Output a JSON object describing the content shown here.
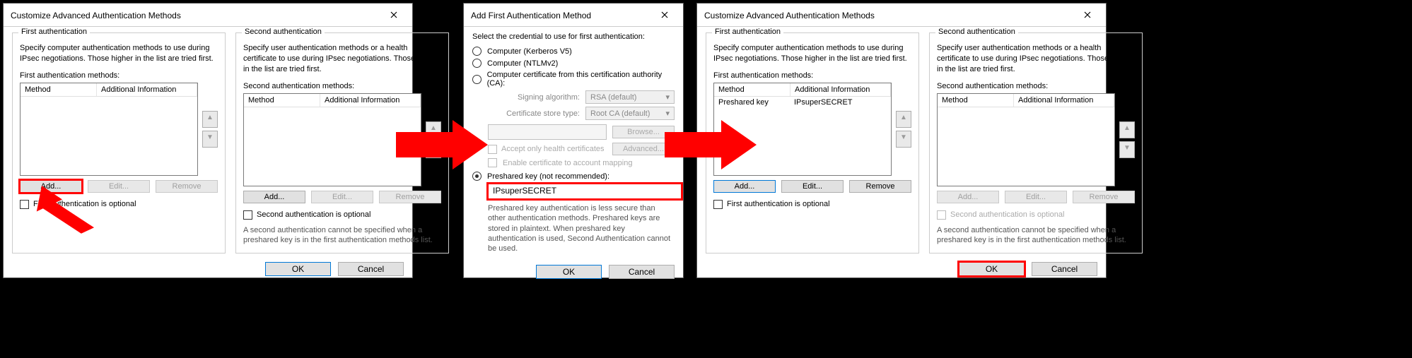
{
  "d1": {
    "title": "Customize Advanced Authentication Methods",
    "first": {
      "legend": "First authentication",
      "desc": "Specify computer authentication methods to use during IPsec negotiations.  Those higher in the list are tried first.",
      "list_label": "First authentication methods:",
      "col_method": "Method",
      "col_addl": "Additional Information",
      "add": "Add...",
      "edit": "Edit...",
      "remove": "Remove",
      "optional": "First authentication is optional"
    },
    "second": {
      "legend": "Second authentication",
      "desc": "Specify user authentication methods or a health certificate to use during IPsec negotiations.  Those higher in the list are tried first.",
      "list_label": "Second authentication methods:",
      "col_method": "Method",
      "col_addl": "Additional Information",
      "add": "Add...",
      "edit": "Edit...",
      "remove": "Remove",
      "optional": "Second authentication is optional",
      "note": "A second authentication cannot be specified when a preshared key is in the first authentication methods list."
    },
    "ok": "OK",
    "cancel": "Cancel"
  },
  "d2": {
    "title": "Add First Authentication Method",
    "intro": "Select the credential to use for first authentication:",
    "r1": "Computer (Kerberos V5)",
    "r2": "Computer (NTLMv2)",
    "r3": "Computer certificate from this certification authority (CA):",
    "signing_label": "Signing algorithm:",
    "signing_val": "RSA (default)",
    "store_label": "Certificate store type:",
    "store_val": "Root CA (default)",
    "browse": "Browse...",
    "advanced": "Advanced...",
    "chk_health": "Accept only health certificates",
    "chk_mapping": "Enable certificate to account mapping",
    "r4": "Preshared key (not recommended):",
    "psk_value": "IPsuperSECRET",
    "warn": "Preshared key authentication is less secure than other authentication methods. Preshared keys are stored in plaintext. When preshared key authentication is used, Second Authentication cannot be used.",
    "ok": "OK",
    "cancel": "Cancel"
  },
  "d3": {
    "title": "Customize Advanced Authentication Methods",
    "first": {
      "legend": "First authentication",
      "desc": "Specify computer authentication methods to use during IPsec negotiations.  Those higher in the list are tried first.",
      "list_label": "First authentication methods:",
      "col_method": "Method",
      "col_addl": "Additional Information",
      "row_method": "Preshared key",
      "row_addl": "IPsuperSECRET",
      "add": "Add...",
      "edit": "Edit...",
      "remove": "Remove",
      "optional": "First authentication is optional"
    },
    "second": {
      "legend": "Second authentication",
      "desc": "Specify user authentication methods or a health certificate to use during IPsec negotiations.  Those higher in the list are tried first.",
      "list_label": "Second authentication methods:",
      "col_method": "Method",
      "col_addl": "Additional Information",
      "add": "Add...",
      "edit": "Edit...",
      "remove": "Remove",
      "optional": "Second authentication is optional",
      "note": "A second authentication cannot be specified when a preshared key is in the first authentication methods list."
    },
    "ok": "OK",
    "cancel": "Cancel"
  }
}
